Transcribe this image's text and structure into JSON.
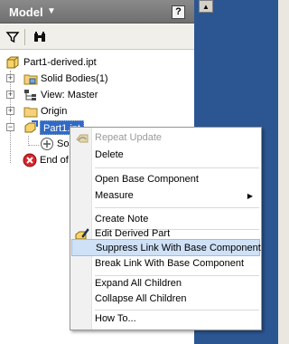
{
  "panel": {
    "title": "Model",
    "help": "?"
  },
  "toolbar": {
    "filter_icon": "filter-icon",
    "find_icon": "binoculars-icon"
  },
  "tree": {
    "root": "Part1-derived.ipt",
    "items": [
      {
        "label": "Solid Bodies(1)",
        "toggle": "+"
      },
      {
        "label": "View: Master",
        "toggle": "+"
      },
      {
        "label": "Origin",
        "toggle": "+"
      },
      {
        "label": "Part1.ipt",
        "toggle": "−",
        "selected": true
      },
      {
        "label": "Sol"
      },
      {
        "label": "End of"
      }
    ]
  },
  "context_menu": {
    "items": [
      {
        "label": "Repeat Update",
        "disabled": true
      },
      {
        "label": "Delete"
      },
      {
        "label": "Open Base Component"
      },
      {
        "label": "Measure",
        "submenu": true
      },
      {
        "label": "Create Note"
      },
      {
        "label": "Edit Derived Part"
      },
      {
        "label": "Suppress Link With Base Component",
        "highlighted": true
      },
      {
        "label": "Break Link With Base Component"
      },
      {
        "label": "Expand All Children"
      },
      {
        "label": "Collapse All Children"
      },
      {
        "label": "How To..."
      }
    ]
  }
}
